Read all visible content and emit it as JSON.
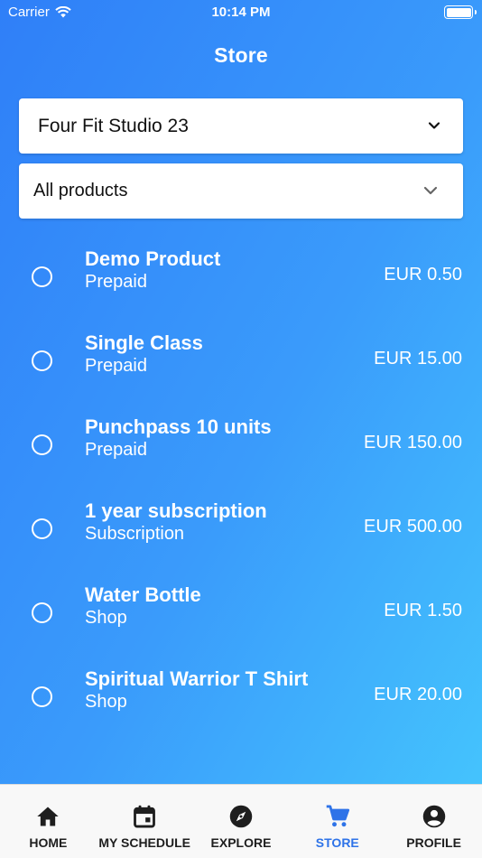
{
  "status_bar": {
    "carrier": "Carrier",
    "time": "10:14 PM"
  },
  "header": {
    "title": "Store"
  },
  "studio_select": {
    "value": "Four Fit Studio 23"
  },
  "filter_select": {
    "value": "All products"
  },
  "products": [
    {
      "name": "Demo Product",
      "type": "Prepaid",
      "price": "EUR 0.50"
    },
    {
      "name": "Single Class",
      "type": "Prepaid",
      "price": "EUR 15.00"
    },
    {
      "name": "Punchpass 10 units",
      "type": "Prepaid",
      "price": "EUR 150.00"
    },
    {
      "name": "1 year subscription",
      "type": "Subscription",
      "price": "EUR 500.00"
    },
    {
      "name": "Water Bottle",
      "type": "Shop",
      "price": "EUR 1.50"
    },
    {
      "name": "Spiritual Warrior T Shirt",
      "type": "Shop",
      "price": "EUR 20.00"
    }
  ],
  "tabs": [
    {
      "label": "HOME",
      "icon": "home-icon"
    },
    {
      "label": "MY SCHEDULE",
      "icon": "calendar-icon"
    },
    {
      "label": "EXPLORE",
      "icon": "compass-icon"
    },
    {
      "label": "STORE",
      "icon": "cart-icon",
      "active": true
    },
    {
      "label": "PROFILE",
      "icon": "profile-icon"
    }
  ],
  "colors": {
    "gradient_start": "#2f7ff8",
    "gradient_end": "#44c3fd",
    "active_tab": "#2e73e8"
  }
}
